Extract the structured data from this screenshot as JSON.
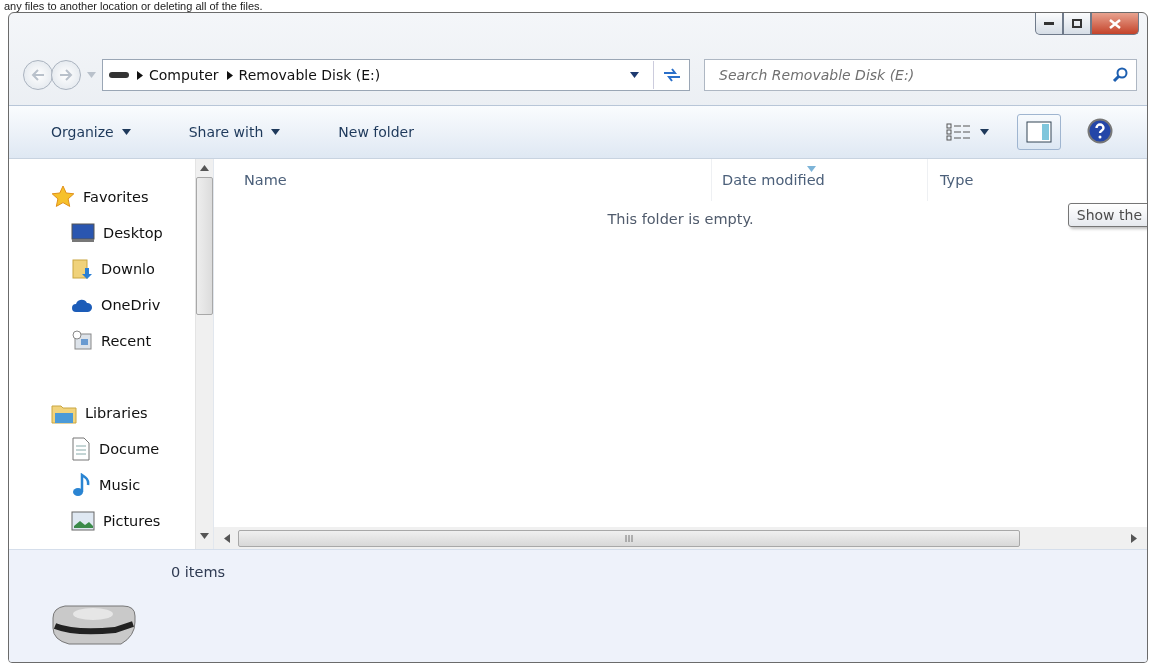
{
  "caption": "any files to another location or deleting all of the files.",
  "window": {
    "controls": [
      {
        "kind": "minimize"
      },
      {
        "kind": "maximize"
      },
      {
        "kind": "close"
      }
    ]
  },
  "address_bar": {
    "crumbs": [
      "Computer",
      "Removable Disk (E:)"
    ]
  },
  "search": {
    "placeholder": "Search Removable Disk (E:)"
  },
  "toolbar": {
    "items": [
      {
        "label": "Organize",
        "dropdown": true
      },
      {
        "label": "Share with",
        "dropdown": true
      },
      {
        "label": "New folder",
        "dropdown": false
      }
    ],
    "preview_pane": {
      "selected": true
    }
  },
  "sidebar": {
    "groups": [
      {
        "label": "Favorites",
        "children": [
          {
            "label": "Desktop"
          },
          {
            "label": "Downlo"
          },
          {
            "label": "OneDriv"
          },
          {
            "label": "Recent"
          }
        ]
      },
      {
        "label": "Libraries",
        "children": [
          {
            "label": "Docume"
          },
          {
            "label": "Music"
          },
          {
            "label": "Pictures"
          }
        ]
      }
    ]
  },
  "table": {
    "columns": [
      {
        "label": "Name",
        "sorted": false
      },
      {
        "label": "Date modified",
        "sorted": true
      },
      {
        "label": "Type",
        "sorted": false
      }
    ],
    "empty_message": "This folder is empty."
  },
  "tooltip": "Show the",
  "details": {
    "count": "0 items"
  }
}
